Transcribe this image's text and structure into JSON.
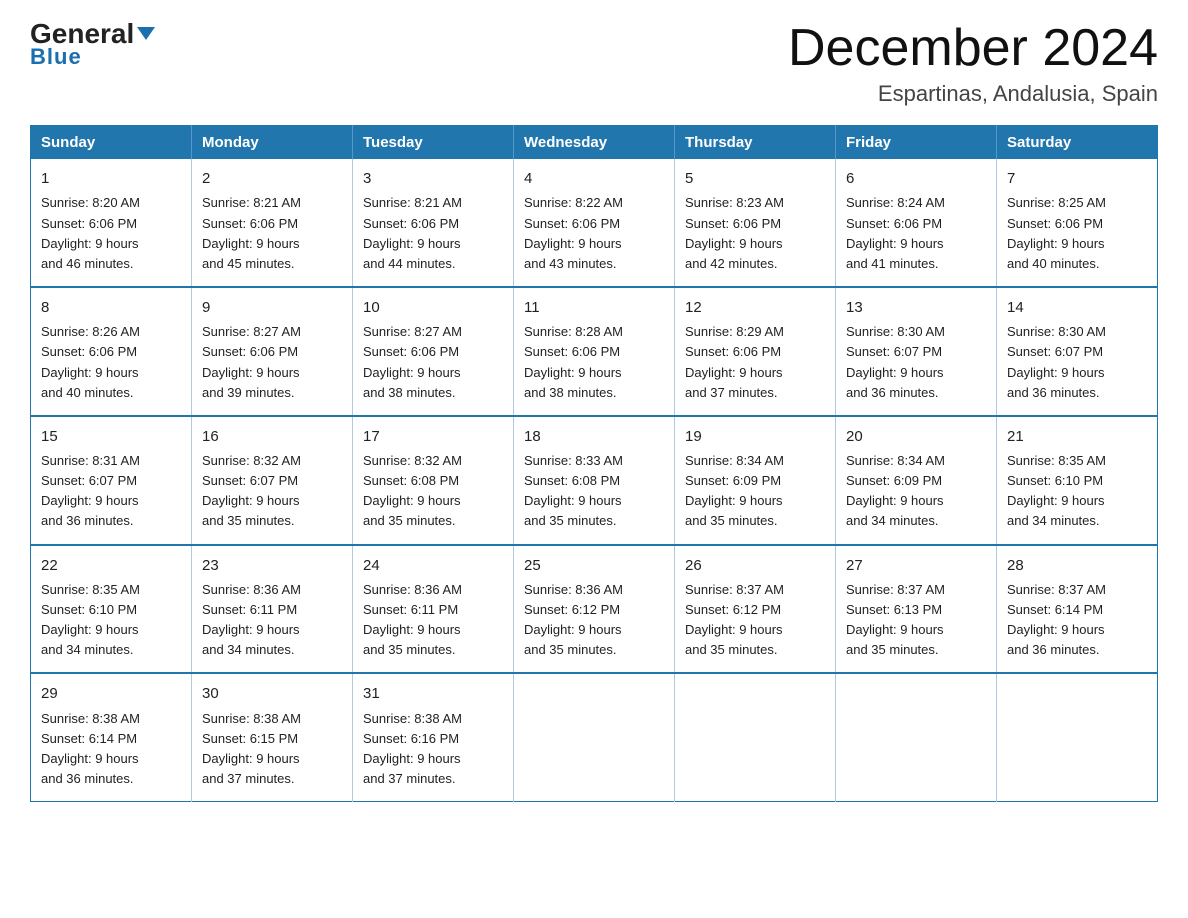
{
  "logo": {
    "general": "General",
    "blue": "Blue",
    "arrow": "▼"
  },
  "header": {
    "month": "December 2024",
    "location": "Espartinas, Andalusia, Spain"
  },
  "weekdays": [
    "Sunday",
    "Monday",
    "Tuesday",
    "Wednesday",
    "Thursday",
    "Friday",
    "Saturday"
  ],
  "weeks": [
    [
      {
        "day": 1,
        "sunrise": "8:20 AM",
        "sunset": "6:06 PM",
        "daylight": "9 hours and 46 minutes."
      },
      {
        "day": 2,
        "sunrise": "8:21 AM",
        "sunset": "6:06 PM",
        "daylight": "9 hours and 45 minutes."
      },
      {
        "day": 3,
        "sunrise": "8:21 AM",
        "sunset": "6:06 PM",
        "daylight": "9 hours and 44 minutes."
      },
      {
        "day": 4,
        "sunrise": "8:22 AM",
        "sunset": "6:06 PM",
        "daylight": "9 hours and 43 minutes."
      },
      {
        "day": 5,
        "sunrise": "8:23 AM",
        "sunset": "6:06 PM",
        "daylight": "9 hours and 42 minutes."
      },
      {
        "day": 6,
        "sunrise": "8:24 AM",
        "sunset": "6:06 PM",
        "daylight": "9 hours and 41 minutes."
      },
      {
        "day": 7,
        "sunrise": "8:25 AM",
        "sunset": "6:06 PM",
        "daylight": "9 hours and 40 minutes."
      }
    ],
    [
      {
        "day": 8,
        "sunrise": "8:26 AM",
        "sunset": "6:06 PM",
        "daylight": "9 hours and 40 minutes."
      },
      {
        "day": 9,
        "sunrise": "8:27 AM",
        "sunset": "6:06 PM",
        "daylight": "9 hours and 39 minutes."
      },
      {
        "day": 10,
        "sunrise": "8:27 AM",
        "sunset": "6:06 PM",
        "daylight": "9 hours and 38 minutes."
      },
      {
        "day": 11,
        "sunrise": "8:28 AM",
        "sunset": "6:06 PM",
        "daylight": "9 hours and 38 minutes."
      },
      {
        "day": 12,
        "sunrise": "8:29 AM",
        "sunset": "6:06 PM",
        "daylight": "9 hours and 37 minutes."
      },
      {
        "day": 13,
        "sunrise": "8:30 AM",
        "sunset": "6:07 PM",
        "daylight": "9 hours and 36 minutes."
      },
      {
        "day": 14,
        "sunrise": "8:30 AM",
        "sunset": "6:07 PM",
        "daylight": "9 hours and 36 minutes."
      }
    ],
    [
      {
        "day": 15,
        "sunrise": "8:31 AM",
        "sunset": "6:07 PM",
        "daylight": "9 hours and 36 minutes."
      },
      {
        "day": 16,
        "sunrise": "8:32 AM",
        "sunset": "6:07 PM",
        "daylight": "9 hours and 35 minutes."
      },
      {
        "day": 17,
        "sunrise": "8:32 AM",
        "sunset": "6:08 PM",
        "daylight": "9 hours and 35 minutes."
      },
      {
        "day": 18,
        "sunrise": "8:33 AM",
        "sunset": "6:08 PM",
        "daylight": "9 hours and 35 minutes."
      },
      {
        "day": 19,
        "sunrise": "8:34 AM",
        "sunset": "6:09 PM",
        "daylight": "9 hours and 35 minutes."
      },
      {
        "day": 20,
        "sunrise": "8:34 AM",
        "sunset": "6:09 PM",
        "daylight": "9 hours and 34 minutes."
      },
      {
        "day": 21,
        "sunrise": "8:35 AM",
        "sunset": "6:10 PM",
        "daylight": "9 hours and 34 minutes."
      }
    ],
    [
      {
        "day": 22,
        "sunrise": "8:35 AM",
        "sunset": "6:10 PM",
        "daylight": "9 hours and 34 minutes."
      },
      {
        "day": 23,
        "sunrise": "8:36 AM",
        "sunset": "6:11 PM",
        "daylight": "9 hours and 34 minutes."
      },
      {
        "day": 24,
        "sunrise": "8:36 AM",
        "sunset": "6:11 PM",
        "daylight": "9 hours and 35 minutes."
      },
      {
        "day": 25,
        "sunrise": "8:36 AM",
        "sunset": "6:12 PM",
        "daylight": "9 hours and 35 minutes."
      },
      {
        "day": 26,
        "sunrise": "8:37 AM",
        "sunset": "6:12 PM",
        "daylight": "9 hours and 35 minutes."
      },
      {
        "day": 27,
        "sunrise": "8:37 AM",
        "sunset": "6:13 PM",
        "daylight": "9 hours and 35 minutes."
      },
      {
        "day": 28,
        "sunrise": "8:37 AM",
        "sunset": "6:14 PM",
        "daylight": "9 hours and 36 minutes."
      }
    ],
    [
      {
        "day": 29,
        "sunrise": "8:38 AM",
        "sunset": "6:14 PM",
        "daylight": "9 hours and 36 minutes."
      },
      {
        "day": 30,
        "sunrise": "8:38 AM",
        "sunset": "6:15 PM",
        "daylight": "9 hours and 37 minutes."
      },
      {
        "day": 31,
        "sunrise": "8:38 AM",
        "sunset": "6:16 PM",
        "daylight": "9 hours and 37 minutes."
      },
      null,
      null,
      null,
      null
    ]
  ],
  "labels": {
    "sunrise": "Sunrise:",
    "sunset": "Sunset:",
    "daylight": "Daylight:"
  }
}
